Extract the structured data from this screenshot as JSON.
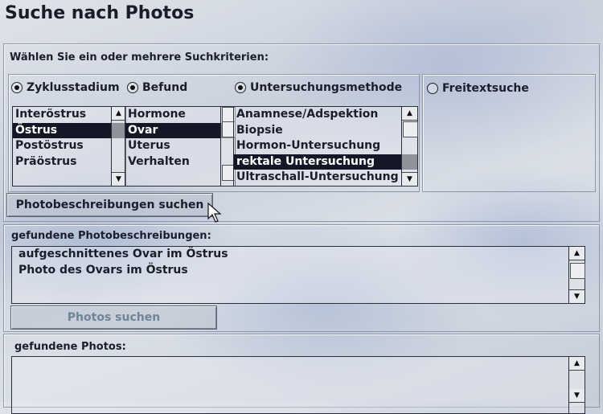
{
  "window": {
    "title": "Suche nach Photos"
  },
  "criteria": {
    "heading": "Wählen Sie ein oder mehrere Suchkriterien:",
    "radios": [
      {
        "label": "Zyklusstadium",
        "checked": true
      },
      {
        "label": "Befund",
        "checked": true
      },
      {
        "label": "Untersuchungsmethode",
        "checked": true
      },
      {
        "label": "Freitextsuche",
        "checked": false
      }
    ],
    "lists": {
      "zyklus": {
        "items": [
          "Interöstrus",
          "Östrus",
          "Postöstrus",
          "Präöstrus"
        ],
        "selected": 1
      },
      "befund": {
        "items": [
          "Hormone",
          "Ovar",
          "Uterus",
          "Verhalten"
        ],
        "selected": 1
      },
      "methode": {
        "items": [
          "Anamnese/Adspektion",
          "Biopsie",
          "Hormon-Untersuchung",
          "rektale Untersuchung",
          "Ultraschall-Untersuchung"
        ],
        "selected": 3
      }
    },
    "search_button": "Photobeschreibungen suchen"
  },
  "descriptions": {
    "heading": "gefundene Photobeschreibungen:",
    "items": [
      "aufgeschnittenes Ovar im Östrus",
      "Photo des Ovars im Östrus"
    ],
    "photos_button": "Photos suchen"
  },
  "photos": {
    "heading": "gefundene Photos:"
  },
  "icons": {
    "scroll_up": "arrow-up-icon",
    "scroll_down": "arrow-down-icon",
    "cursor": "mouse-pointer-icon"
  }
}
